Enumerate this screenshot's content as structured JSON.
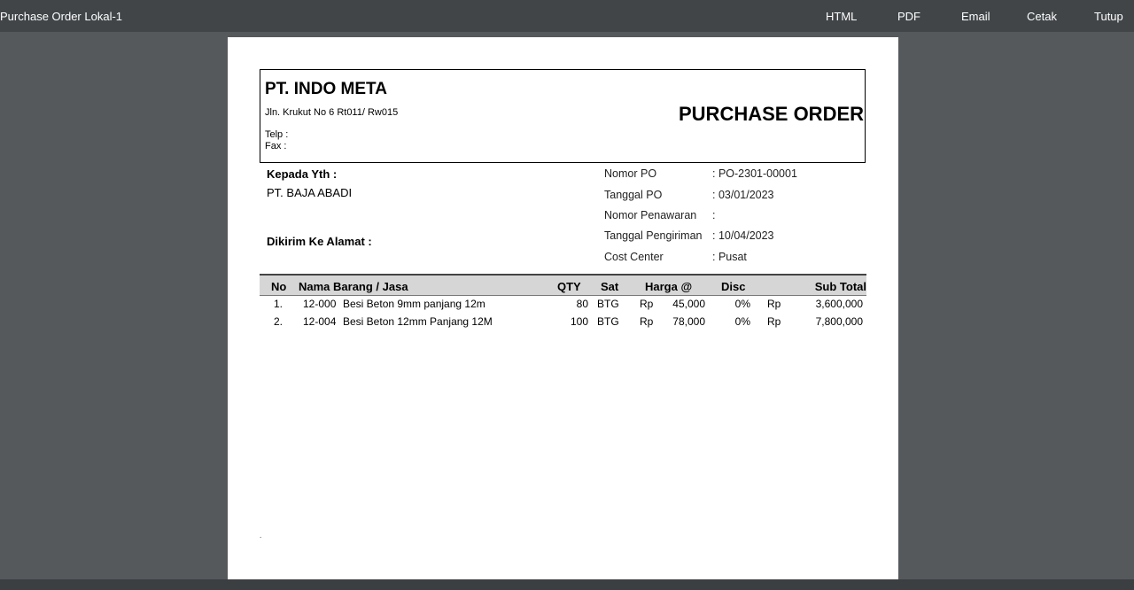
{
  "window": {
    "title": "Purchase Order Lokal-1"
  },
  "toolbar": {
    "html_label": "HTML",
    "pdf_label": "PDF",
    "email_label": "Email",
    "print_label": "Cetak",
    "close_label": "Tutup"
  },
  "document": {
    "company_name": "PT. INDO META",
    "company_address": "Jln. Krukut No 6 Rt011/ Rw015",
    "telp_label": "Telp :",
    "fax_label": "Fax :",
    "doc_title": "PURCHASE ORDER",
    "to_label": "Kepada Yth :",
    "to_value": "PT. BAJA ABADI",
    "ship_to_label": "Dikirim Ke Alamat :",
    "info": [
      {
        "label": "Nomor PO",
        "value": ": PO-2301-00001"
      },
      {
        "label": "Tanggal PO",
        "value": ": 03/01/2023"
      },
      {
        "label": "Nomor Penawaran",
        "value": ":"
      },
      {
        "label": "Tanggal Pengiriman",
        "value": ": 10/04/2023"
      },
      {
        "label": "Cost Center",
        "value": ": Pusat"
      }
    ],
    "table": {
      "headers": {
        "no": "No",
        "name": "Nama Barang / Jasa",
        "qty": "QTY",
        "unit": "Sat",
        "price": "Harga @",
        "disc": "Disc",
        "subtotal": "Sub Total"
      },
      "rows": [
        {
          "no": "1.",
          "code": "12-000",
          "name": "Besi Beton 9mm panjang 12m",
          "qty": "80",
          "unit": "BTG",
          "cur": "Rp",
          "price": "45,000",
          "disc": "0%",
          "cur2": "Rp",
          "subtotal": "3,600,000"
        },
        {
          "no": "2.",
          "code": "12-004",
          "name": "Besi Beton 12mm Panjang 12M",
          "qty": "100",
          "unit": "BTG",
          "cur": "Rp",
          "price": "78,000",
          "disc": "0%",
          "cur2": "Rp",
          "subtotal": "7,800,000"
        }
      ]
    },
    "footer_mark": "."
  }
}
